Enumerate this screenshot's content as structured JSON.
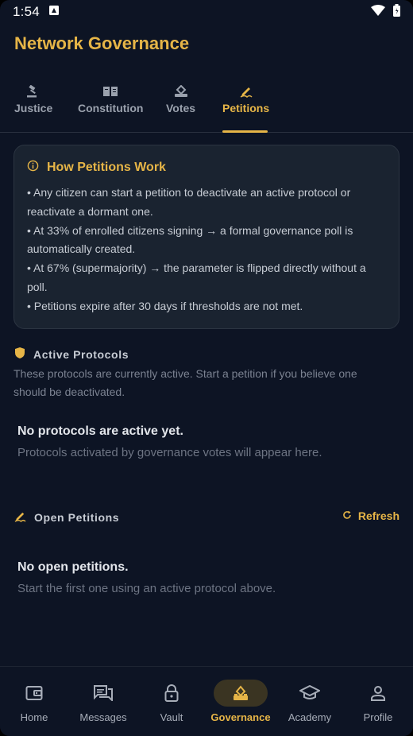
{
  "status_bar": {
    "time": "1:54"
  },
  "header": {
    "title": "Network Governance"
  },
  "tabs": [
    {
      "label": "Justice",
      "icon": "gavel-icon"
    },
    {
      "label": "Constitution",
      "icon": "book-icon"
    },
    {
      "label": "Votes",
      "icon": "ballot-icon"
    },
    {
      "label": "Petitions",
      "icon": "sign-icon",
      "active": true
    }
  ],
  "info_card": {
    "title": "How Petitions Work",
    "lines": [
      "• Any citizen can start a petition to deactivate an active protocol or",
      "reactivate a dormant one.",
      "• At 33% of enrolled citizens signing → a formal governance poll is",
      "automatically created.",
      "• At 67% (supermajority) → the parameter is flipped directly without a",
      "poll.",
      "• Petitions expire after 30 days if thresholds are not met."
    ]
  },
  "active_protocols": {
    "title": "Active Protocols",
    "desc_lines": [
      "These protocols are currently active. Start a petition if you believe one",
      "should be deactivated."
    ],
    "empty_title": "No protocols are active yet.",
    "empty_desc": "Protocols activated by governance votes will appear here."
  },
  "open_petitions": {
    "title": "Open Petitions",
    "refresh_label": "Refresh",
    "empty_title": "No open petitions.",
    "empty_desc": "Start the first one using an active protocol above."
  },
  "bottom_nav": [
    {
      "label": "Home",
      "icon": "wallet-icon"
    },
    {
      "label": "Messages",
      "icon": "chat-icon"
    },
    {
      "label": "Vault",
      "icon": "lock-icon"
    },
    {
      "label": "Governance",
      "icon": "ballot-icon",
      "active": true
    },
    {
      "label": "Academy",
      "icon": "graduation-cap-icon"
    },
    {
      "label": "Profile",
      "icon": "person-icon"
    }
  ],
  "colors": {
    "accent": "#e6b547",
    "background": "#0d1424",
    "card": "#1a2330"
  }
}
